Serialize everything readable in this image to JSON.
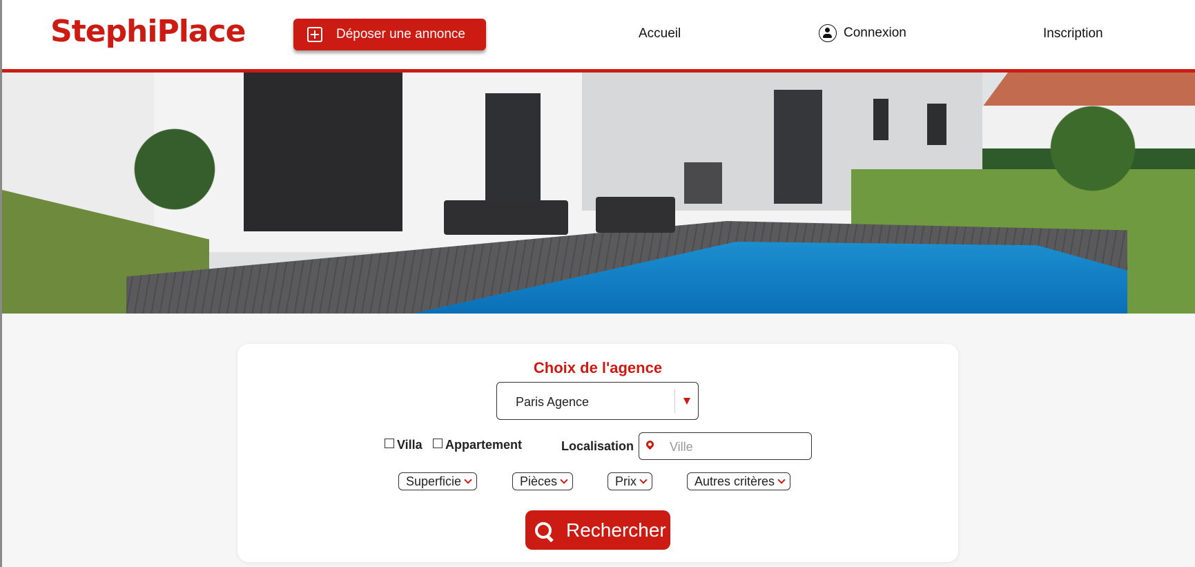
{
  "header": {
    "logo": "StephiPlace",
    "post_ad_label": "Déposer une annonce",
    "nav": {
      "home": "Accueil",
      "login": "Connexion",
      "signup": "Inscription"
    }
  },
  "hero": {
    "image_subject": "modern-house-with-pool"
  },
  "search": {
    "agency_title": "Choix de l'agence",
    "agency_selected": "Paris Agence",
    "property_types": [
      "Villa",
      "Appartement"
    ],
    "location_label": "Localisation",
    "location_placeholder": "Ville",
    "filters": [
      "Superficie",
      "Pièces",
      "Prix",
      "Autres critères"
    ],
    "submit_label": "Rechercher"
  },
  "colors": {
    "brand_red": "#cc1b12",
    "background": "#f6f6f6"
  }
}
